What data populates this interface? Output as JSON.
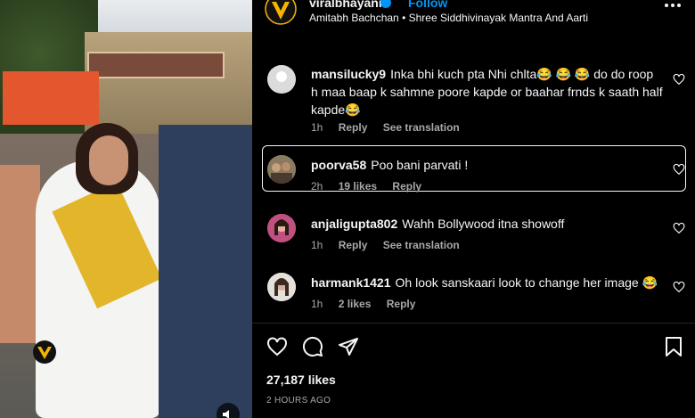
{
  "post": {
    "username": "viralbhayani",
    "follow_label": "Follow",
    "subtitle": "Amitabh Bachchan • Shree Siddhivinayak Mantra And Aarti",
    "likes": "27,187 likes",
    "time_ago": "2 HOURS AGO"
  },
  "comments": [
    {
      "user": "mansilucky9",
      "text": "Inka bhi kuch pta Nhi chlta😂 😂 😂 do do roop h maa baap k sahmne poore kapde or baahar frnds k saath half kapde😂",
      "time": "1h",
      "likes": "",
      "reply": "Reply",
      "translate": "See translation"
    },
    {
      "user": "poorva58",
      "text": "Poo bani parvati !",
      "time": "2h",
      "likes": "19 likes",
      "reply": "Reply",
      "translate": ""
    },
    {
      "user": "anjaligupta802",
      "text": "Wahh Bollywood itna showoff",
      "time": "1h",
      "likes": "",
      "reply": "Reply",
      "translate": "See translation"
    },
    {
      "user": "harmank1421",
      "text": "Oh look sanskaari look to change her image 😂",
      "time": "1h",
      "likes": "2 likes",
      "reply": "Reply",
      "translate": ""
    }
  ],
  "icons": [
    "like-icon",
    "comment-icon",
    "share-icon",
    "save-icon",
    "more-icon",
    "verified-icon",
    "mute-icon"
  ],
  "colors": {
    "accent": "#0095f6",
    "background": "#000000",
    "muted": "#a8a8a8"
  }
}
